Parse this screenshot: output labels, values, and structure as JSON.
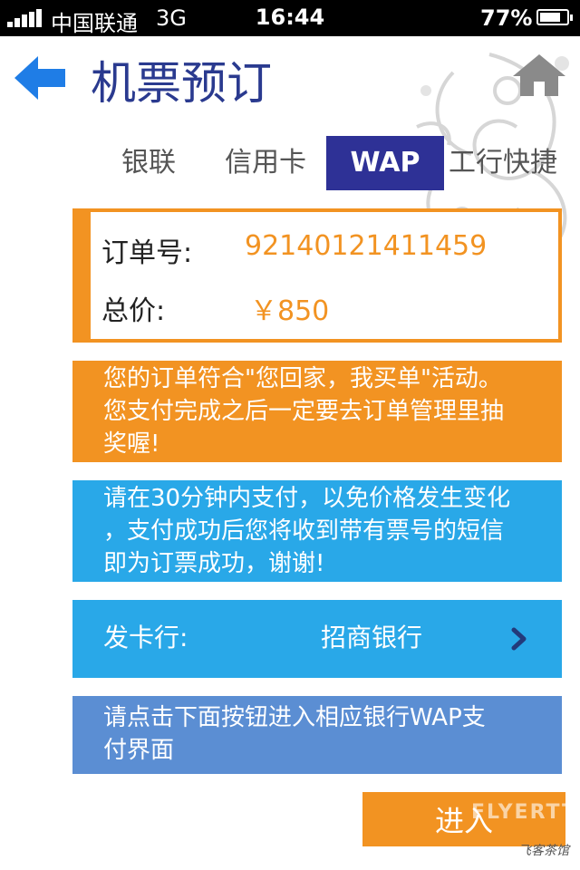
{
  "status_bar": {
    "carrier": "中国联通",
    "network": "3G",
    "time": "16:44",
    "battery": "77%",
    "battery_level": 0.77
  },
  "header": {
    "title": "机票预订",
    "back_icon": "back-arrow-icon",
    "home_icon": "home-icon",
    "accent_color": "#2a3a8f"
  },
  "tabs": [
    {
      "label": "银联",
      "active": false
    },
    {
      "label": "信用卡",
      "active": false
    },
    {
      "label": "WAP",
      "active": true
    },
    {
      "label": "工行快捷",
      "active": false
    }
  ],
  "order": {
    "number_label": "订单号:",
    "number_value": "92140121411459",
    "price_label": "总价:",
    "price_value": "￥850"
  },
  "promo": {
    "lines": [
      "您的订单符合\"您回家，我买单\"活动。",
      "您支付完成之后一定要去订单管理里抽",
      "奖喔!"
    ]
  },
  "timer_notice": {
    "lines": [
      "请在30分钟内支付，以免价格发生变化",
      "，支付成功后您将收到带有票号的短信",
      "即为订票成功，谢谢!"
    ]
  },
  "bank": {
    "label": "发卡行:",
    "value": "招商银行"
  },
  "tip": {
    "lines": [
      "请点击下面按钮进入相应银行WAP支",
      "付界面"
    ]
  },
  "enter_button": {
    "label": "进入"
  },
  "watermark": {
    "text": "FLYERTT",
    "cn": "飞客茶馆"
  },
  "colors": {
    "orange": "#f29322",
    "blue": "#29a8e8",
    "tip_blue": "#5b8ed3",
    "tab_active": "#2e3196"
  }
}
